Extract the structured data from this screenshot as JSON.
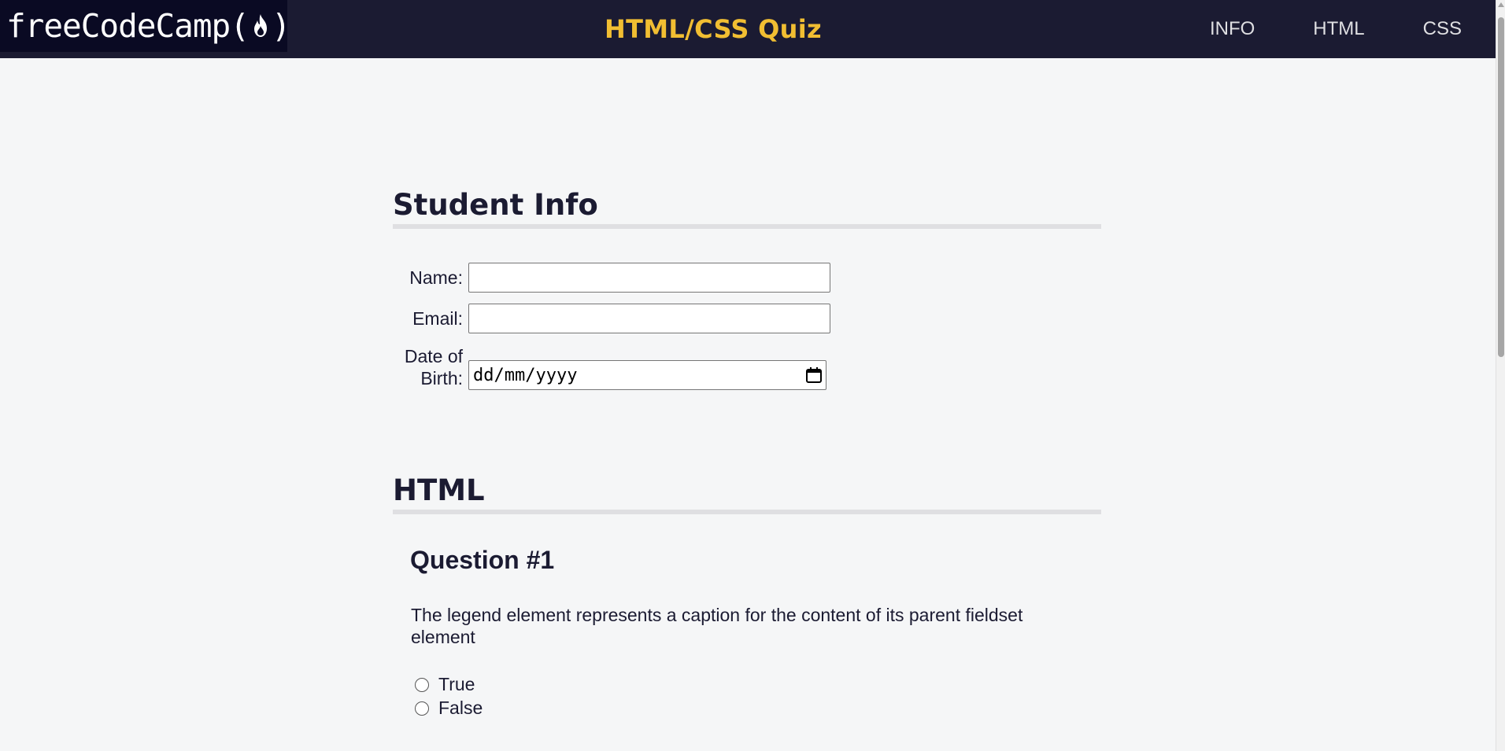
{
  "header": {
    "logo_text": "freeCodeCamp",
    "title": "HTML/CSS Quiz",
    "nav": [
      "INFO",
      "HTML",
      "CSS"
    ]
  },
  "student_info": {
    "heading": "Student Info",
    "name_label": "Name:",
    "name_value": "",
    "email_label": "Email:",
    "email_value": "",
    "dob_label_line1": "Date of",
    "dob_label_line2": "Birth:",
    "dob_placeholder": "dd/mm/yyyy"
  },
  "html_section": {
    "heading": "HTML",
    "question1": {
      "title": "Question #1",
      "text": "The legend element represents a caption for the content of its parent fieldset element",
      "options": [
        "True",
        "False"
      ],
      "selected": null
    }
  },
  "colors": {
    "header_bg": "#1b1b32",
    "logo_bg": "#0a0a23",
    "title_accent": "#f1be32",
    "page_bg": "#f5f6f7",
    "text": "#1b1b32"
  },
  "icons": {
    "logo": "flame-icon",
    "date_picker": "calendar-icon"
  }
}
